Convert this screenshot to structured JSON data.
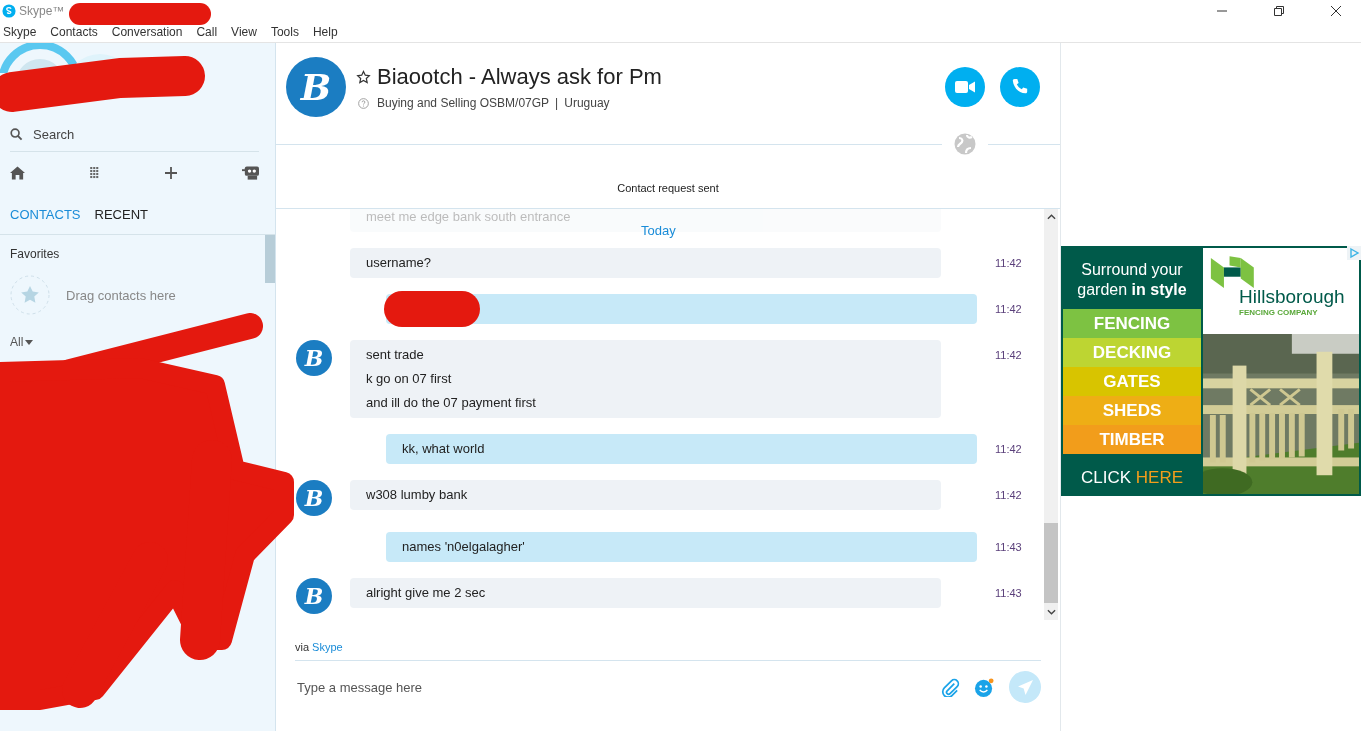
{
  "window": {
    "title": "Skype™"
  },
  "menu": [
    "Skype",
    "Contacts",
    "Conversation",
    "Call",
    "View",
    "Tools",
    "Help"
  ],
  "sidebar": {
    "search": {
      "placeholder": "Search"
    },
    "tabs": [
      {
        "label": "CONTACTS",
        "selected": true
      },
      {
        "label": "RECENT",
        "selected": false
      }
    ],
    "favorites": "Favorites",
    "drop_hint": "Drag contacts here",
    "filter": "All"
  },
  "conversation": {
    "avatar": "B",
    "name": "Biaootch - Always ask for Pm",
    "mood": "Buying and Selling OSBM/07GP",
    "separator": "|",
    "location": "Uruguay",
    "notice": "Contact request sent",
    "day": "Today",
    "messages": [
      {
        "outgoing": false,
        "faded": true,
        "lines": [
          "meet me edge bank south entrance"
        ]
      },
      {
        "outgoing": false,
        "faded": false,
        "lines": [
          "username?"
        ],
        "time": "11:42"
      },
      {
        "outgoing": true,
        "faded": false,
        "redacted": true,
        "time": "11:42"
      },
      {
        "outgoing": false,
        "faded": false,
        "avatar": "B",
        "lines": [
          "sent trade",
          "k go on 07 first",
          "and ill do the 07 payment first"
        ],
        "time": "11:42"
      },
      {
        "outgoing": true,
        "faded": false,
        "lines": [
          "kk, what world"
        ],
        "time": "11:42"
      },
      {
        "outgoing": false,
        "faded": false,
        "avatar": "B",
        "lines": [
          "w308 lumby bank"
        ],
        "time": "11:42"
      },
      {
        "outgoing": true,
        "faded": false,
        "lines": [
          "names 'n0elgalagher'"
        ],
        "time": "11:43"
      },
      {
        "outgoing": false,
        "faded": false,
        "avatar": "B",
        "lines": [
          "alright give me 2 sec"
        ],
        "time": "11:43"
      }
    ],
    "via": "via",
    "via_link": "Skype",
    "composer": {
      "placeholder": "Type a message here"
    }
  },
  "ad": {
    "headline": "Surround your garden **in style**",
    "items": [
      {
        "label": "FENCING",
        "color": "#7dc242"
      },
      {
        "label": "DECKING",
        "color": "#bdd532"
      },
      {
        "label": "GATES",
        "color": "#d8c400"
      },
      {
        "label": "SHEDS",
        "color": "#eeae15"
      },
      {
        "label": "TIMBER",
        "color": "#f29d1b"
      }
    ],
    "cta": "CLICK",
    "cta_highlight": "HERE",
    "brand": "Hillsborough",
    "brand_tagline": "FENCING COMPANY",
    "kind": "picture"
  }
}
